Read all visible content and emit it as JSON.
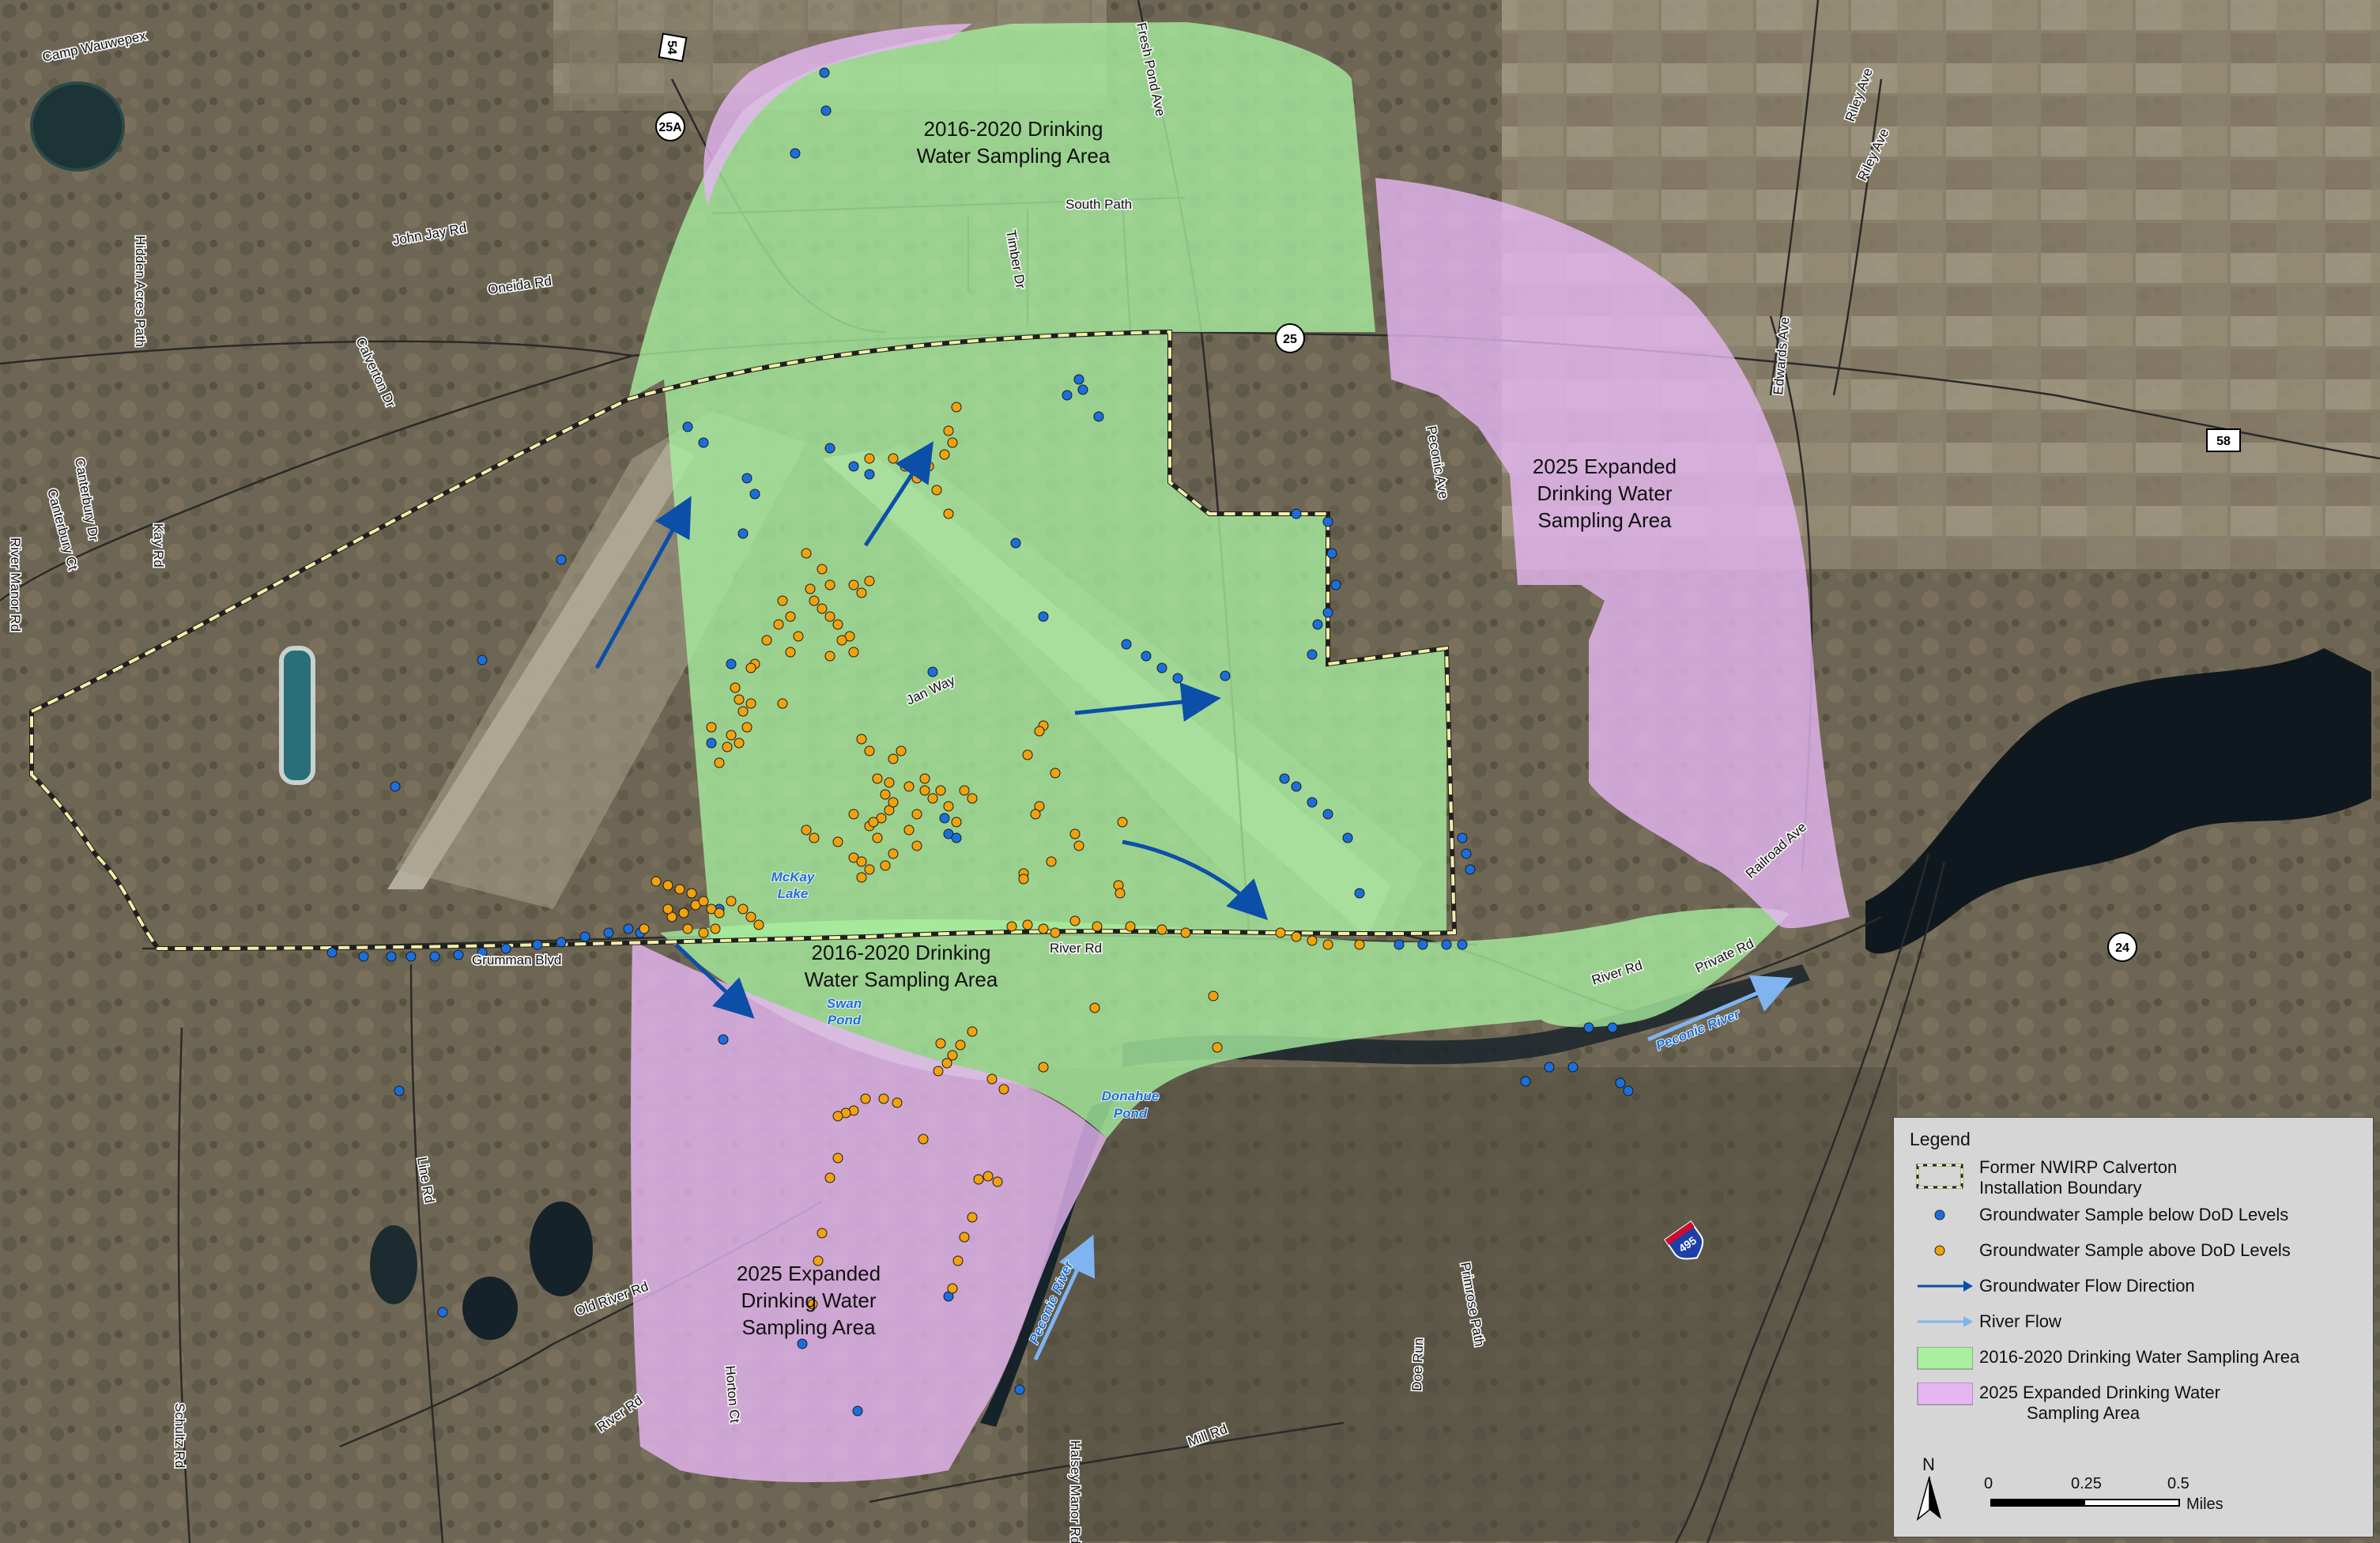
{
  "map": {
    "colors": {
      "green_area": "#a8f0a0",
      "purple_area": "#e6b6f2",
      "below_levels": "#1a6fdc",
      "above_levels": "#f2a20c",
      "groundwater_flow": "#0b4fa8",
      "river_flow": "#7fb4f0",
      "boundary": "#f3f0a8"
    },
    "area_labels": {
      "green_north": [
        "2016-2020 Drinking",
        "Water Sampling Area"
      ],
      "green_south": [
        "2016-2020 Drinking",
        "Water Sampling Area"
      ],
      "purple_east": [
        "2025 Expanded",
        "Drinking Water",
        "Sampling Area"
      ],
      "purple_southwest": [
        "2025 Expanded",
        "Drinking Water",
        "Sampling Area"
      ]
    },
    "water_labels": {
      "mckay": [
        "McKay",
        "Lake"
      ],
      "swan": [
        "Swan",
        "Pond"
      ],
      "donahue": [
        "Donahue",
        "Pond"
      ],
      "peconic_east": "Peconic River",
      "peconic_south": "Peconic River"
    },
    "road_labels": {
      "camp_wauwepex": "Camp Wauwepex",
      "fresh_pond_ave": "Fresh Pond Ave",
      "south_path": "South Path",
      "timber_dr": "Timber Dr",
      "john_jay_rd": "John Jay Rd",
      "oneida_rd": "Oneida Rd",
      "calverton_dr": "Calverton Dr",
      "hidden_acres_path": "Hidden Acres Path",
      "kay_rd": "Kay Rd",
      "canterbury_dr": "Canterbury Dr",
      "canterbury_ct": "Canterbury Ct",
      "river_manor_rd": "River Manor Rd",
      "riley_ave_1": "Riley Ave",
      "riley_ave_2": "Riley Ave",
      "edwards_ave": "Edwards Ave",
      "peconic_ave": "Peconic Ave",
      "jan_way": "Jan Way",
      "grumman_blvd": "Grumman Blvd",
      "river_rd_north": "River Rd",
      "river_rd_east": "River Rd",
      "private_rd": "Private Rd",
      "railroad_ave": "Railroad Ave",
      "line_rd": "Line Rd",
      "old_river_rd": "Old River Rd",
      "horton_ct": "Horton Ct",
      "river_rd_south": "River Rd",
      "schultz_rd": "Schultz Rd",
      "halsey_manor_rd": "Halsey Manor Rd",
      "mill_rd": "Mill Rd",
      "doe_run": "Doe Run",
      "primrose_path": "Primrose Path"
    },
    "shields": {
      "route_54": "54",
      "route_25a": "25A",
      "route_25": "25",
      "route_58": "58",
      "route_24": "24",
      "interstate_495": "495"
    }
  },
  "legend": {
    "title": "Legend",
    "items": [
      {
        "type": "boundary",
        "label": [
          "Former NWIRP Calverton",
          "Installation Boundary"
        ]
      },
      {
        "type": "blue_dot",
        "label": [
          "Groundwater Sample below DoD Levels"
        ]
      },
      {
        "type": "orange_dot",
        "label": [
          "Groundwater Sample above DoD Levels"
        ]
      },
      {
        "type": "flow_arrow",
        "label": [
          "Groundwater Flow Direction"
        ]
      },
      {
        "type": "river_arrow",
        "label": [
          "River Flow"
        ]
      },
      {
        "type": "green_box",
        "label": [
          "2016-2020 Drinking Water Sampling Area"
        ]
      },
      {
        "type": "purple_box",
        "label": [
          "2025 Expanded Drinking Water",
          "Sampling Area"
        ]
      }
    ],
    "north": "N",
    "scale": {
      "ticks": [
        "0",
        "0.25",
        "0.5"
      ],
      "unit": "Miles"
    }
  }
}
